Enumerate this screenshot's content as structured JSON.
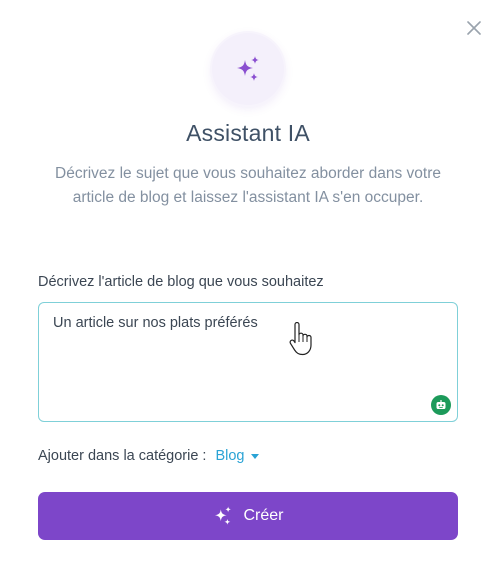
{
  "dialog": {
    "close_icon": "close-icon",
    "hero_icon": "sparkles-icon",
    "title": "Assistant IA",
    "subtitle": "Décrivez le sujet que vous souhaitez aborder dans votre article de blog et laissez l'assistant IA s'en occuper."
  },
  "form": {
    "prompt_label": "Décrivez l'article de blog que vous souhaitez",
    "prompt_value": "Un article sur nos plats préférés",
    "assistant_icon": "robot-icon",
    "category_label": "Ajouter dans la catégorie :",
    "category_value": "Blog"
  },
  "actions": {
    "create_label": "Créer",
    "create_icon": "sparkles-icon"
  },
  "colors": {
    "accent": "#7d46c9",
    "link": "#2aa3d5",
    "focus_border": "#7fd0d8",
    "bot_badge": "#1c9a5a"
  }
}
